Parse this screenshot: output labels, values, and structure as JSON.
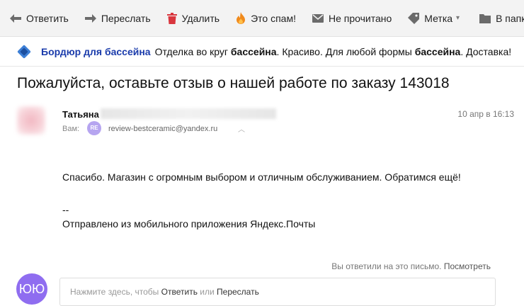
{
  "toolbar": {
    "reply": "Ответить",
    "forward": "Переслать",
    "delete": "Удалить",
    "spam": "Это спам!",
    "unread": "Не прочитано",
    "label": "Метка",
    "folder": "В папку",
    "caret": "▾"
  },
  "ad": {
    "title": "Бордюр для бассейна",
    "text_1": "Отделка во круг ",
    "bold_1": "бассейна",
    "text_2": ". Красиво. Для любой формы ",
    "bold_2": "бассейна",
    "text_3": ". Доставка!"
  },
  "email": {
    "subject": "Пожалуйста, оставьте отзыв о нашей работе по заказу 143018",
    "sender_name": "Татьяна",
    "date": "10 апр в 16:13",
    "to_label": "Вам:",
    "to_badge": "RE",
    "to_address": "review-bestceramic@yandex.ru",
    "to_chevron": "︿",
    "body_line_1": "Спасибо. Магазин с огромным выбором и отличным обслуживанием. Обратимся ещё!",
    "signature_dash": "--",
    "signature": "Отправлено из мобильного приложения Яндекс.Почты"
  },
  "reply_status": {
    "text": "Вы ответили на это письмо.",
    "link": "Посмотреть"
  },
  "quick_reply": {
    "avatar_initials": "ЮЮ",
    "prefix": "Нажмите здесь, чтобы ",
    "reply_link": "Ответить",
    "middle": " или ",
    "forward_link": "Переслать"
  },
  "colors": {
    "accent": "#1a3bab",
    "avatar_me": "#8f6df0",
    "badge": "#b6a5f0",
    "delete_icon": "#d9363e",
    "spam_icon": "#f08a1c"
  },
  "icons": [
    "reply-arrow-icon",
    "forward-arrow-icon",
    "trash-icon",
    "flame-icon",
    "envelope-icon",
    "tag-icon",
    "folder-icon",
    "ad-logo-icon"
  ]
}
